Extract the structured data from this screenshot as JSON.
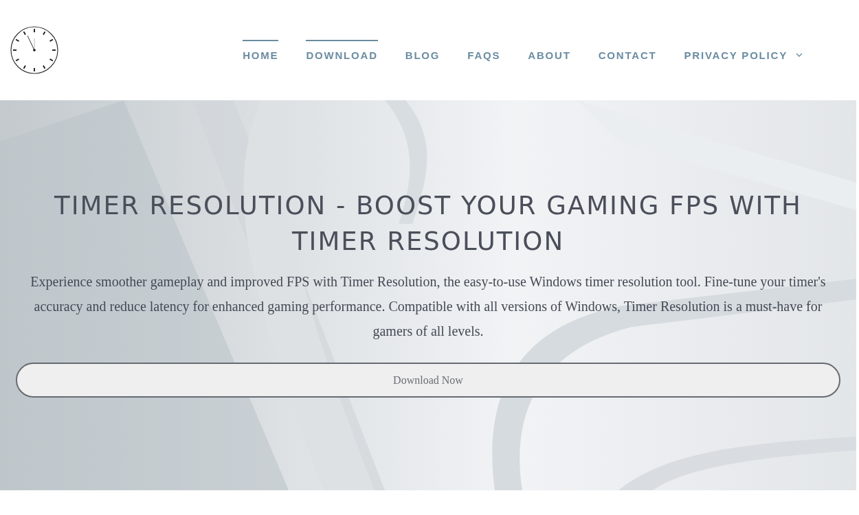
{
  "nav": [
    {
      "label": "HOME",
      "selected": true,
      "dropdown": false
    },
    {
      "label": "DOWNLOAD",
      "selected": true,
      "dropdown": false
    },
    {
      "label": "BLOG",
      "selected": false,
      "dropdown": false
    },
    {
      "label": "FAQS",
      "selected": false,
      "dropdown": false
    },
    {
      "label": "ABOUT",
      "selected": false,
      "dropdown": false
    },
    {
      "label": "CONTACT",
      "selected": false,
      "dropdown": false
    },
    {
      "label": "PRIVACY POLICY",
      "selected": false,
      "dropdown": true
    }
  ],
  "hero": {
    "title": "TIMER RESOLUTION - BOOST YOUR GAMING FPS WITH TIMER RESOLUTION",
    "text": "Experience smoother gameplay and improved FPS with Timer Resolution, the easy-to-use Windows timer resolution tool. Fine-tune your timer's accuracy and reduce latency for enhanced gaming performance. Compatible with all versions of Windows, Timer Resolution is a must-have for gamers of all levels.",
    "button": "Download Now"
  }
}
